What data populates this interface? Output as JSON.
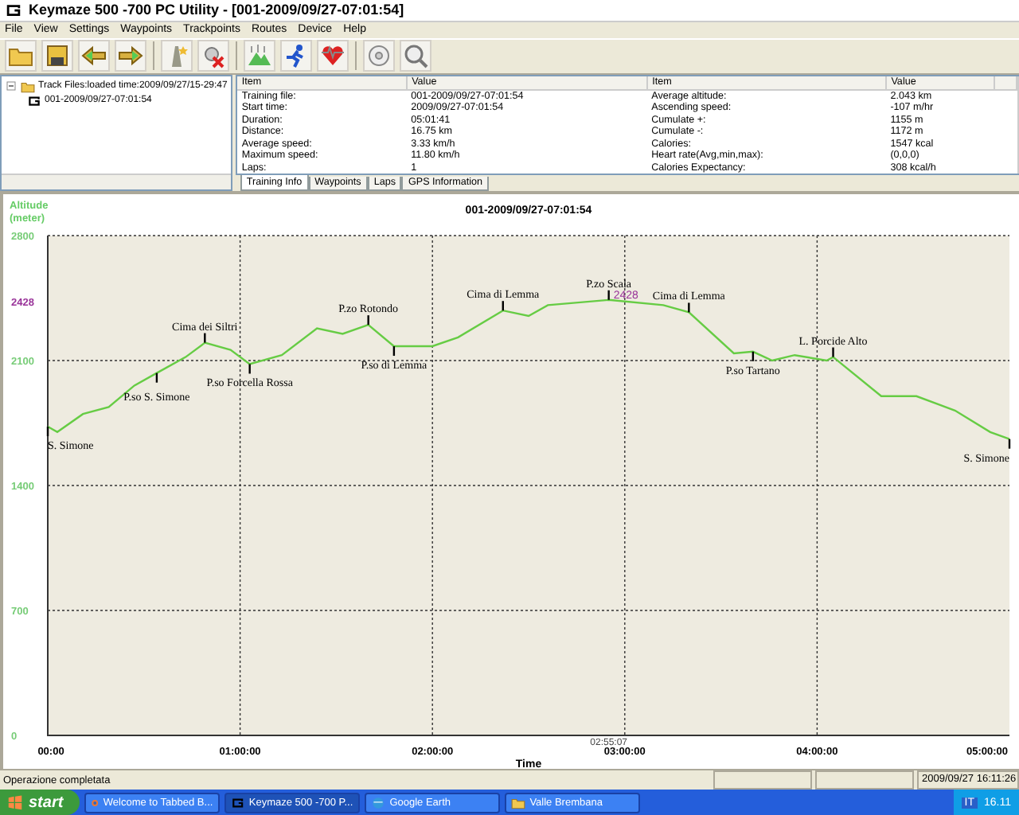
{
  "window": {
    "title": "Keymaze 500 -700 PC Utility - [001-2009/09/27-07:01:54]"
  },
  "menu": [
    "File",
    "View",
    "Settings",
    "Waypoints",
    "Trackpoints",
    "Routes",
    "Device",
    "Help"
  ],
  "track_tree": {
    "label": "Track Files:loaded time:2009/09/27/15-29:47",
    "expanded": true,
    "children": [
      {
        "label": "001-2009/09/27-07:01:54"
      }
    ]
  },
  "info_table": {
    "columns": [
      "Item",
      "Value",
      "Item",
      "Value"
    ],
    "rows": [
      [
        "Training file:",
        "001-2009/09/27-07:01:54",
        "Average altitude:",
        "2.043 km"
      ],
      [
        "Start time:",
        "2009/09/27-07:01:54",
        "Ascending speed:",
        "-107  m/hr"
      ],
      [
        "Duration:",
        "05:01:41",
        "Cumulate +:",
        "1155 m"
      ],
      [
        "Distance:",
        "16.75 km",
        "Cumulate -:",
        "1172 m"
      ],
      [
        "Average speed:",
        "3.33 km/h",
        "Calories:",
        "1547 kcal"
      ],
      [
        "Maximum speed:",
        "11.80 km/h",
        "Heart rate(Avg,min,max):",
        "(0,0,0)"
      ],
      [
        "Laps:",
        "1",
        "Calories Expectancy:",
        "308  kcal/h"
      ]
    ]
  },
  "info_tabs": [
    {
      "label": "Training Info",
      "selected": true
    },
    {
      "label": "Waypoints",
      "selected": false
    },
    {
      "label": "Laps",
      "selected": false
    },
    {
      "label": "GPS Information",
      "selected": false
    }
  ],
  "chart": {
    "chart_data": {
      "type": "line",
      "title": "001-2009/09/27-07:01:54",
      "xlabel": "Time",
      "ylabel": "Altitude (meter)",
      "x": [
        0,
        3,
        11,
        19,
        27,
        34,
        43,
        49,
        57,
        63,
        73,
        84,
        92,
        100,
        108,
        120,
        128,
        142,
        150,
        156,
        175,
        192,
        200,
        214,
        220,
        226,
        233,
        243,
        245,
        260,
        271,
        283,
        294,
        300
      ],
      "series": [
        {
          "color": "#66cc44",
          "values": [
            1730,
            1700,
            1800,
            1840,
            1960,
            2030,
            2120,
            2200,
            2160,
            2080,
            2130,
            2280,
            2250,
            2300,
            2180,
            2180,
            2230,
            2380,
            2350,
            2410,
            2440,
            2410,
            2370,
            2140,
            2150,
            2100,
            2130,
            2100,
            2120,
            1900,
            1900,
            1820,
            1700,
            1660
          ]
        }
      ],
      "xlim": [
        0,
        300
      ],
      "ylim": [
        0,
        2800
      ],
      "grid": true,
      "xticks": [
        {
          "value": 0,
          "label": "00:00"
        },
        {
          "value": 60,
          "label": "01:00:00"
        },
        {
          "value": 120,
          "label": "02:00:00"
        },
        {
          "value": 180,
          "label": "03:00:00"
        },
        {
          "value": 240,
          "label": "04:00:00"
        },
        {
          "value": 300,
          "label": "05:00:00"
        }
      ],
      "yticks": [
        0,
        700,
        1400,
        2100,
        {
          "value": 2428,
          "label": "2428"
        },
        2800
      ],
      "annotations": [
        {
          "text": "S. Simone",
          "x": 0,
          "y": 1730
        },
        {
          "text": "P.so S. Simone",
          "x": 34,
          "y": 2030
        },
        {
          "text": "Cima dei Siltri",
          "x": 49,
          "y": 2200
        },
        {
          "text": "P.so Forcella Rossa",
          "x": 63,
          "y": 2080
        },
        {
          "text": "P.zo Rotondo",
          "x": 100,
          "y": 2300
        },
        {
          "text": "P.so di Lemma",
          "x": 108,
          "y": 2180
        },
        {
          "text": "Cima di Lemma",
          "x": 142,
          "y": 2380
        },
        {
          "text": "P.zo Scala",
          "x": 175,
          "y": 2440
        },
        {
          "text": "2428",
          "x": 175,
          "y": 2440
        },
        "02:55:07",
        {
          "text": "Cima di Lemma",
          "x": 200,
          "y": 2370
        },
        {
          "text": "P.so Tartano",
          "x": 220,
          "y": 2150
        },
        {
          "text": "L. Porcide Alto",
          "x": 245,
          "y": 2120
        },
        {
          "text": "S. Simone",
          "x": 300,
          "y": 1660
        }
      ]
    }
  },
  "status_bar": {
    "message": "Operazione completata",
    "timestamp": "2009/09/27 16:11:26"
  },
  "taskbar": {
    "start": "start",
    "tasks": [
      {
        "label": "Welcome to Tabbed B...",
        "selected": false
      },
      {
        "label": "Keymaze 500 -700 P...",
        "selected": true
      },
      {
        "label": "Google Earth",
        "selected": false
      },
      {
        "label": "Valle Brembana",
        "selected": false
      }
    ],
    "tray_language": "IT",
    "clock": "16.11"
  }
}
